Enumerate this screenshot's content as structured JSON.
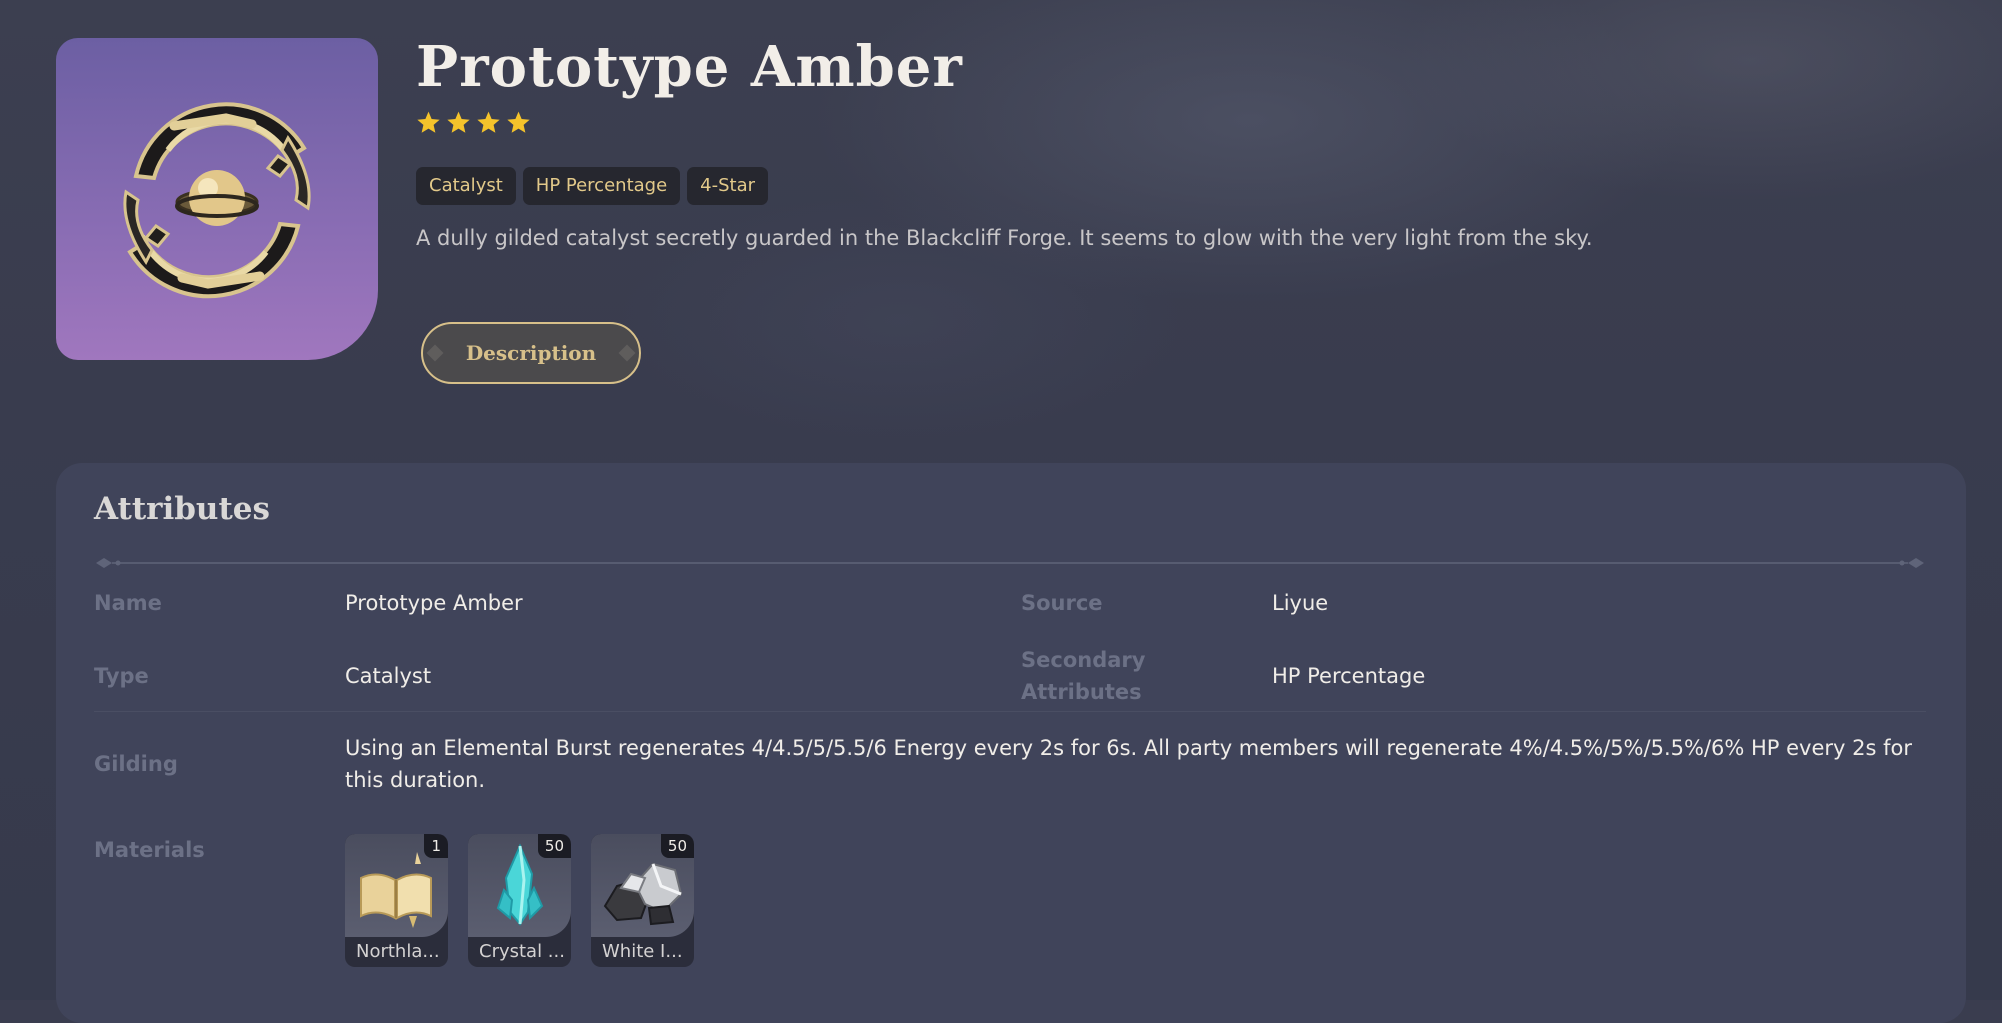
{
  "weapon": {
    "name": "Prototype Amber",
    "rarity": 4,
    "tags": [
      "Catalyst",
      "HP Percentage",
      "4-Star"
    ],
    "description": "A dully gilded catalyst secretly guarded in the Blackcliff Forge. It seems to glow with the very light from the sky.",
    "description_button": "Description"
  },
  "attributes": {
    "title": "Attributes",
    "name_label": "Name",
    "name_value": "Prototype Amber",
    "source_label": "Source",
    "source_value": "Liyue",
    "type_label": "Type",
    "type_value": "Catalyst",
    "secondary_label_line1": "Secondary",
    "secondary_label_line2": "Attributes",
    "secondary_value": "HP Percentage",
    "gilding_label": "Gilding",
    "gilding_value": "Using an Elemental Burst regenerates 4/4.5/5/5.5/6 Energy every 2s for 6s. All party members will regenerate 4%/4.5%/5%/5.5%/6% HP every 2s for this duration.",
    "materials_label": "Materials",
    "materials": [
      {
        "name": "Northla...",
        "count": "1",
        "icon": "book-icon"
      },
      {
        "name": "Crystal ...",
        "count": "50",
        "icon": "crystal-icon"
      },
      {
        "name": "White I...",
        "count": "50",
        "icon": "iron-ore-icon"
      }
    ]
  },
  "colors": {
    "accent_gold": "#d7c08a",
    "star": "#f5c32b",
    "panel": "#40445a",
    "icon_bg_purple": "#8a6db4"
  }
}
